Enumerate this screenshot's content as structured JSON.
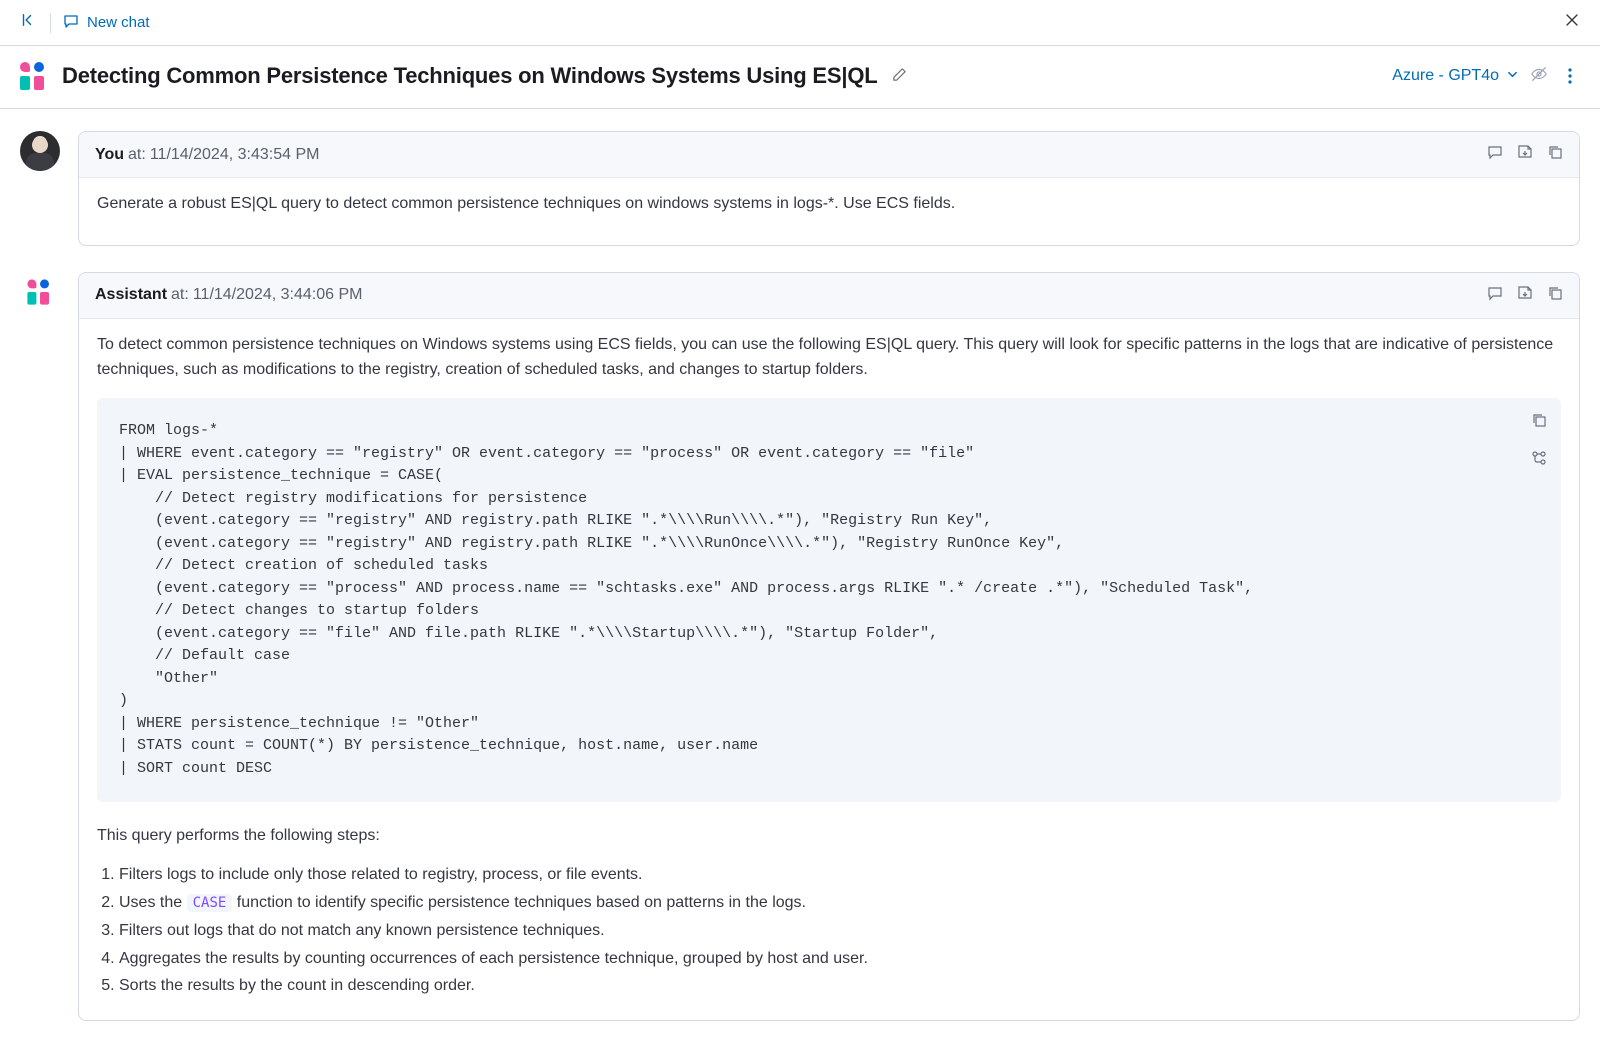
{
  "topbar": {
    "new_chat": "New chat"
  },
  "header": {
    "title": "Detecting Common Persistence Techniques on Windows Systems Using ES|QL",
    "model": "Azure - GPT4o"
  },
  "user_msg": {
    "role": "You",
    "at_label": "at:",
    "timestamp": "11/14/2024, 3:43:54 PM",
    "body": "Generate a robust ES|QL query to detect common persistence techniques on windows systems in logs-*. Use ECS fields."
  },
  "assist_msg": {
    "role": "Assistant",
    "at_label": "at:",
    "timestamp": "11/14/2024, 3:44:06 PM",
    "intro": "To detect common persistence techniques on Windows systems using ECS fields, you can use the following ES|QL query. This query will look for specific patterns in the logs that are indicative of persistence techniques, such as modifications to the registry, creation of scheduled tasks, and changes to startup folders.",
    "code": "FROM logs-*\n| WHERE event.category == \"registry\" OR event.category == \"process\" OR event.category == \"file\"\n| EVAL persistence_technique = CASE(\n    // Detect registry modifications for persistence\n    (event.category == \"registry\" AND registry.path RLIKE \".*\\\\\\\\Run\\\\\\\\.*\"), \"Registry Run Key\",\n    (event.category == \"registry\" AND registry.path RLIKE \".*\\\\\\\\RunOnce\\\\\\\\.*\"), \"Registry RunOnce Key\",\n    // Detect creation of scheduled tasks\n    (event.category == \"process\" AND process.name == \"schtasks.exe\" AND process.args RLIKE \".* /create .*\"), \"Scheduled Task\",\n    // Detect changes to startup folders\n    (event.category == \"file\" AND file.path RLIKE \".*\\\\\\\\Startup\\\\\\\\.*\"), \"Startup Folder\",\n    // Default case\n    \"Other\"\n)\n| WHERE persistence_technique != \"Other\"\n| STATS count = COUNT(*) BY persistence_technique, host.name, user.name\n| SORT count DESC",
    "steps_intro": "This query performs the following steps:",
    "inline_code": "CASE",
    "steps": [
      "Filters logs to include only those related to registry, process, or file events.",
      "Uses the |CASE| function to identify specific persistence techniques based on patterns in the logs.",
      "Filters out logs that do not match any known persistence techniques.",
      "Aggregates the results by counting occurrences of each persistence technique, grouped by host and user.",
      "Sorts the results by the count in descending order."
    ]
  }
}
